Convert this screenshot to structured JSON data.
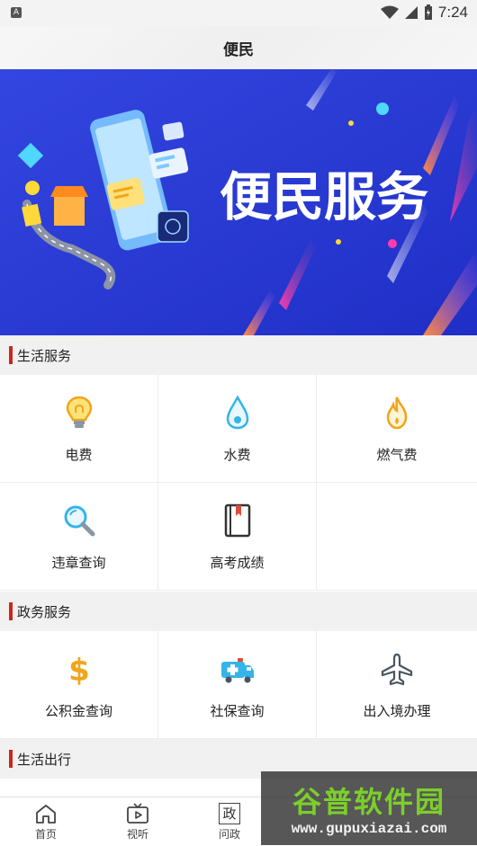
{
  "status_bar": {
    "time": "7:24"
  },
  "header": {
    "title": "便民"
  },
  "banner": {
    "headline": "便民服务"
  },
  "sections": [
    {
      "title": "生活服务",
      "items": [
        {
          "label": "电费",
          "icon": "lightbulb-icon",
          "color": "#f2a51a"
        },
        {
          "label": "水费",
          "icon": "water-drop-icon",
          "color": "#35b4e8"
        },
        {
          "label": "燃气费",
          "icon": "flame-icon",
          "color": "#f2a51a"
        },
        {
          "label": "违章查询",
          "icon": "magnifier-icon",
          "color": "#35b4e8"
        },
        {
          "label": "高考成绩",
          "icon": "book-icon",
          "color": "#333333"
        }
      ]
    },
    {
      "title": "政务服务",
      "items": [
        {
          "label": "公积金查询",
          "icon": "dollar-icon",
          "color": "#f2a51a"
        },
        {
          "label": "社保查询",
          "icon": "ambulance-icon",
          "color": "#35b4e8"
        },
        {
          "label": "出入境办理",
          "icon": "airplane-icon",
          "color": "#4a5560"
        }
      ]
    },
    {
      "title": "生活出行"
    }
  ],
  "bottom_nav": [
    {
      "label": "首页",
      "icon": "home-icon"
    },
    {
      "label": "视听",
      "icon": "tv-play-icon"
    },
    {
      "label": "问政",
      "icon": "zheng-icon",
      "glyph": "政"
    }
  ],
  "watermark": {
    "title": "谷普软件园",
    "url": "www.gupuxiazai.com"
  },
  "colors": {
    "accent": "#c8281e",
    "banner_bg": "#2a39d8"
  }
}
